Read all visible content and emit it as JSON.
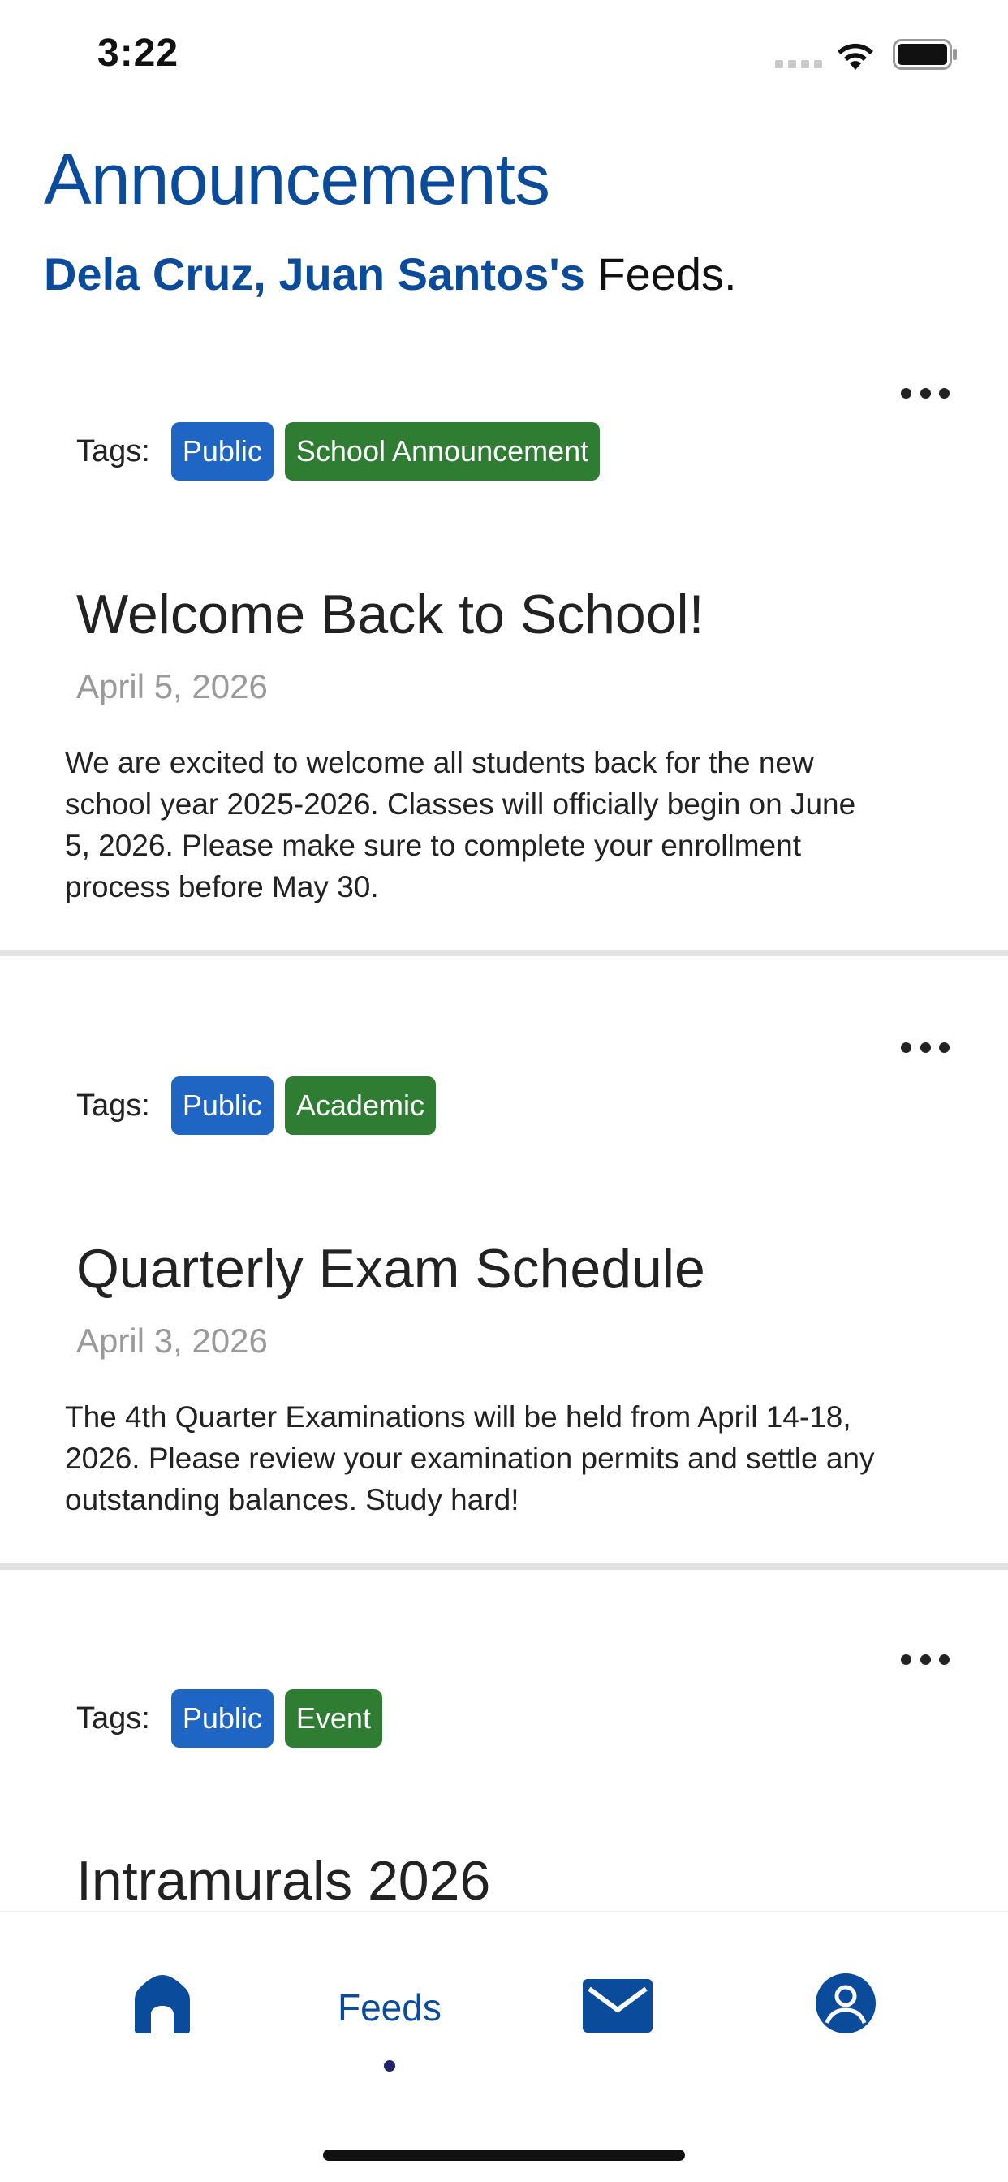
{
  "status_bar": {
    "time": "3:22"
  },
  "header": {
    "title": "Announcements",
    "user_name": "Dela Cruz, Juan Santos's",
    "feeds_suffix": "Feeds."
  },
  "colors": {
    "brand_blue": "#0b4b9b",
    "tag_public": "#1f65c3",
    "tag_category": "#2e7d32",
    "date_gray": "#9a9a9a"
  },
  "tags_label": "Tags:",
  "posts": [
    {
      "tags": [
        "Public",
        "School Announcement"
      ],
      "title": "Welcome Back to School!",
      "date": "April 5, 2026",
      "body": "We are excited to welcome all students back for the new school year 2025-2026. Classes will officially begin on June 5, 2026. Please make sure to complete your enrollment process before May 30."
    },
    {
      "tags": [
        "Public",
        "Academic"
      ],
      "title": "Quarterly Exam Schedule",
      "date": "April 3, 2026",
      "body": "The 4th Quarter Examinations will be held from April 14-18, 2026. Please review your examination permits and settle any outstanding balances. Study hard!"
    },
    {
      "tags": [
        "Public",
        "Event"
      ],
      "title": "Intramurals 2026"
    }
  ],
  "bottom_nav": {
    "items": [
      {
        "icon": "home-icon"
      },
      {
        "label": "Feeds",
        "active": true
      },
      {
        "icon": "mail-icon"
      },
      {
        "icon": "profile-icon"
      }
    ]
  }
}
